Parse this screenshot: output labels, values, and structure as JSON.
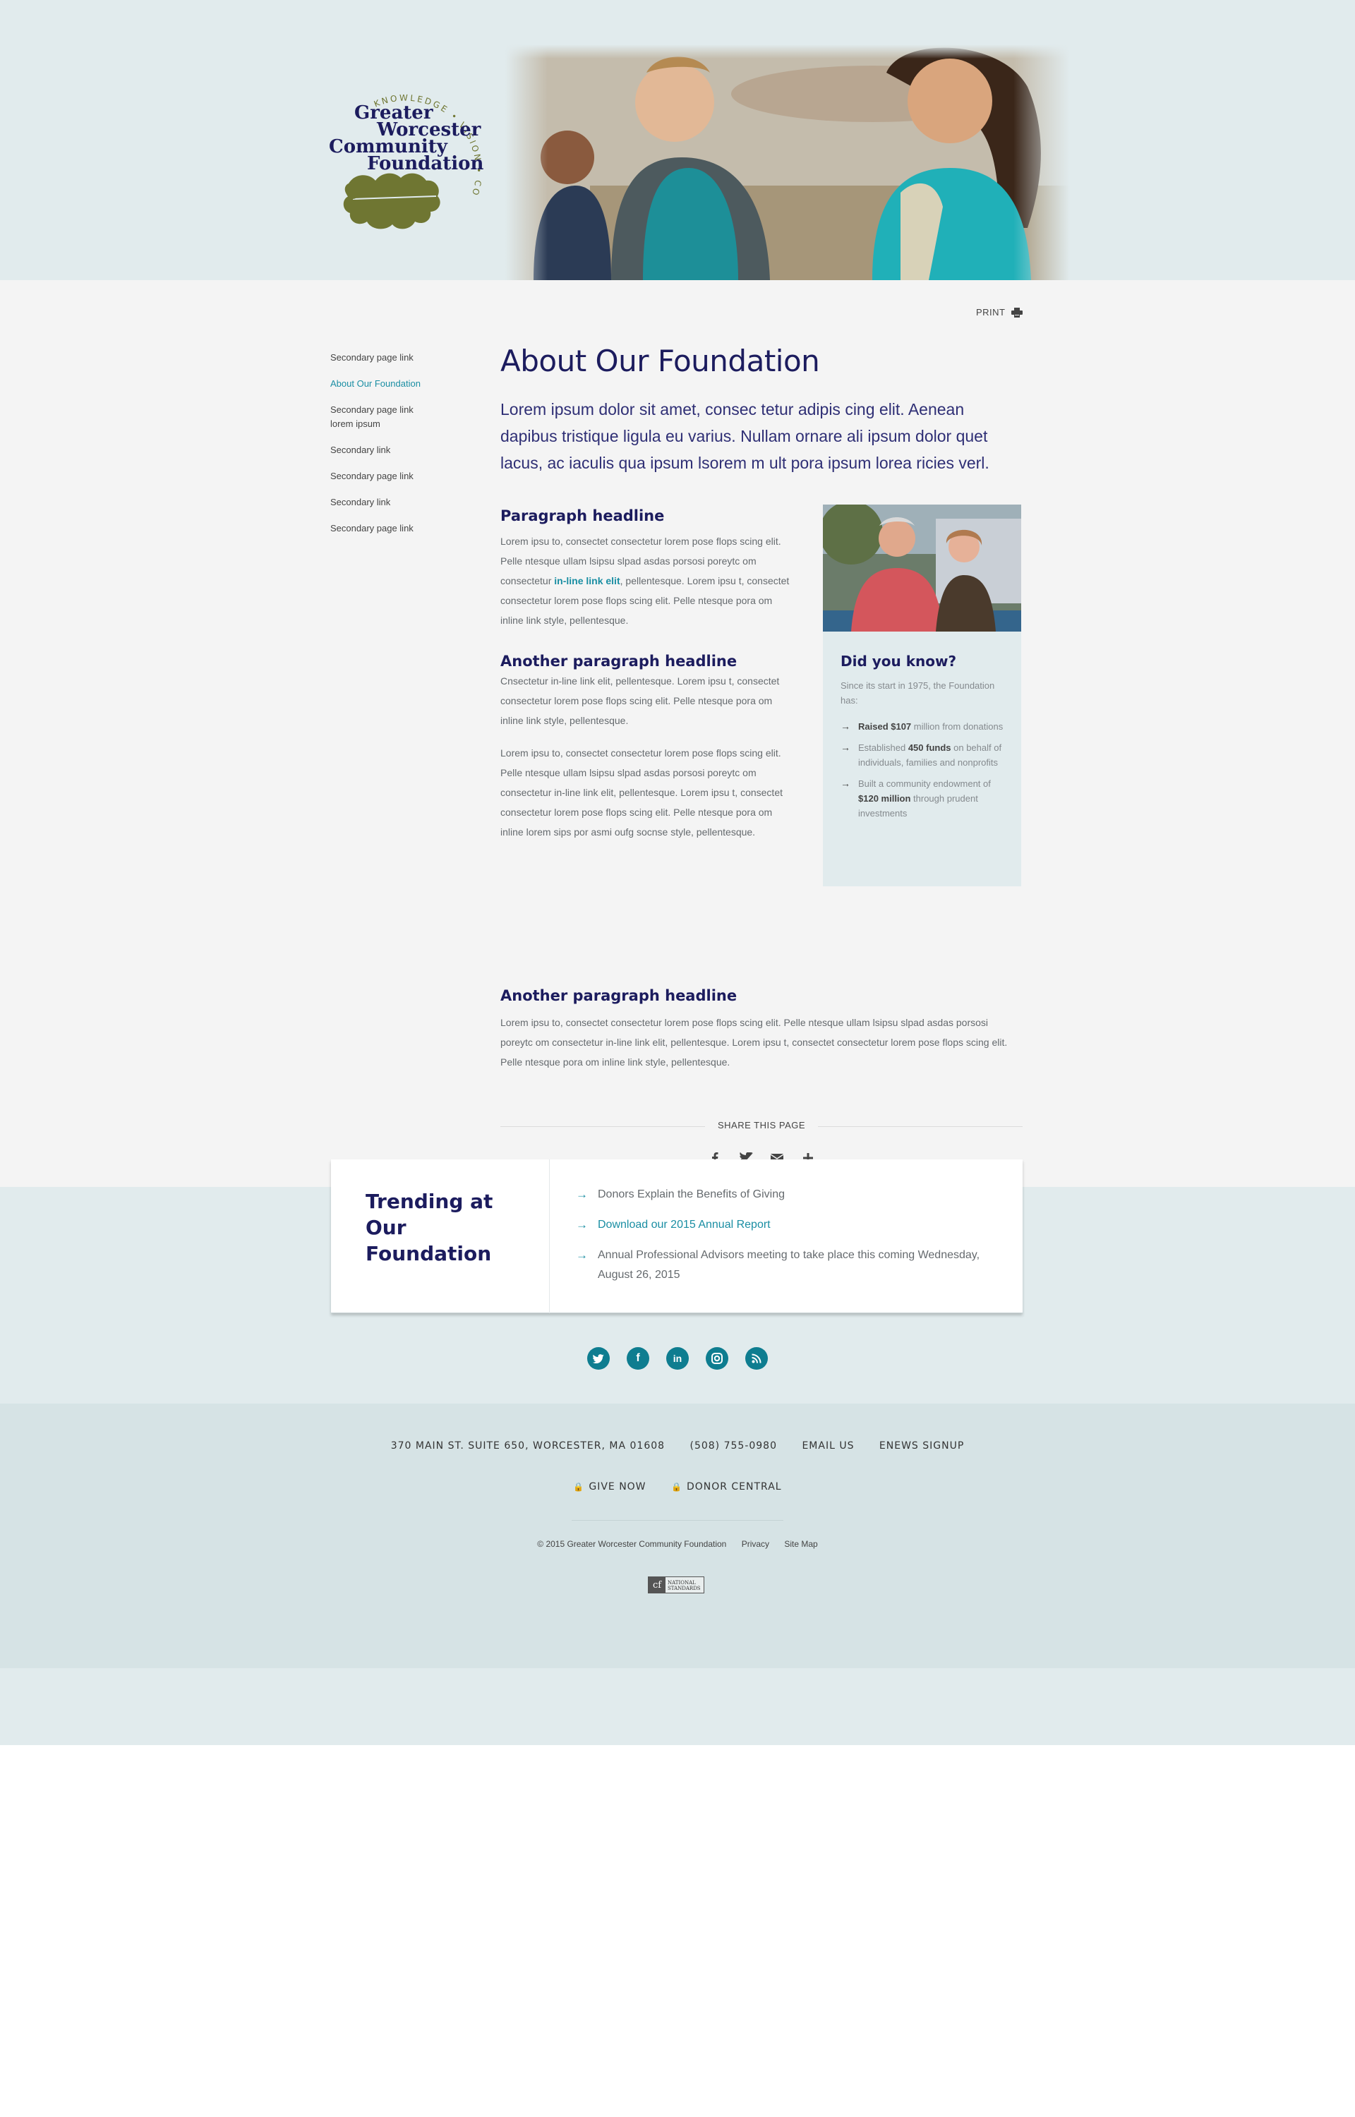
{
  "logo": {
    "name_lines": [
      "Greater",
      "Worcester",
      "Community",
      "Foundation"
    ],
    "tagline": "KNOWLEDGE • VISION • COMMITMENT",
    "leaf_color": "#6f7632"
  },
  "print_label": "PRINT",
  "sidenav": [
    {
      "label": "Secondary page link",
      "active": false
    },
    {
      "label": "About Our Foundation",
      "active": true
    },
    {
      "label": "Secondary page link lorem ipsum",
      "active": false
    },
    {
      "label": "Secondary link",
      "active": false
    },
    {
      "label": "Secondary page link",
      "active": false
    },
    {
      "label": "Secondary link",
      "active": false
    },
    {
      "label": "Secondary page link",
      "active": false
    }
  ],
  "page_title": "About Our Foundation",
  "intro": "Lorem ipsum dolor sit amet, consec tetur adipis cing elit. Aenean dapibus tristique ligula eu varius. Nullam ornare ali ipsum dolor quet lacus, ac iaculis qua ipsum lsorem m ult pora ipsum lorea ricies verl.",
  "section1": {
    "headline": "Paragraph headline",
    "text_before": "Lorem ipsu to, consectet consectetur lorem pose flops scing elit. Pelle ntesque ullam lsipsu slpad asdas porsosi poreytc om consectetur ",
    "link": "in-line link elit",
    "text_after": ", pellentesque. Lorem ipsu t, consectet consectetur lorem pose flops scing elit. Pelle ntesque pora om inline link style, pellentesque."
  },
  "section2": {
    "headline": "Another paragraph headline",
    "para1": "Cnsectetur in-line link elit, pellentesque. Lorem ipsu t, consectet consectetur lorem pose flops scing elit. Pelle ntesque pora om inline link style, pellentesque.",
    "para2": "Lorem ipsu to, consectet consectetur lorem pose flops scing elit. Pelle ntesque ullam lsipsu slpad asdas porsosi poreytc om consectetur in-line link elit, pellentesque. Lorem ipsu t, consectet consectetur lorem pose flops scing elit. Pelle ntesque pora om inline lorem sips por asmi oufg socnse style, pellentesque."
  },
  "section3": {
    "headline": "Another paragraph headline",
    "text": "Lorem ipsu to, consectet consectetur lorem pose flops scing elit. Pelle ntesque ullam lsipsu slpad asdas porsosi poreytc om consectetur in-line link elit, pellentesque. Lorem ipsu t, consectet consectetur lorem pose flops scing elit. Pelle ntesque pora om inline link style, pellentesque."
  },
  "did_you_know": {
    "title": "Did you know?",
    "subtitle": "Since its start in 1975, the Foundation has:",
    "items": [
      {
        "bold": "Raised $107",
        "pre": "",
        "rest": " million from donations"
      },
      {
        "pre": "Established ",
        "bold": "450 funds",
        "rest": " on behalf of individuals, families and nonprofits"
      },
      {
        "pre": "Built a community endowment of ",
        "bold": "$120 million",
        "rest": " through prudent investments"
      }
    ]
  },
  "share": {
    "label": "SHARE THIS PAGE",
    "icons": [
      "facebook-icon",
      "twitter-icon",
      "email-icon",
      "plus-icon"
    ]
  },
  "trending": {
    "title": "Trending at Our Foundation",
    "items": [
      {
        "label": "Donors Explain the Benefits of Giving",
        "link": false
      },
      {
        "label": "Download our 2015 Annual Report",
        "link": true
      },
      {
        "label": "Annual Professional Advisors meeting to take place this coming Wednesday, August 26, 2015",
        "link": false
      }
    ]
  },
  "social_icons": [
    "twitter-icon",
    "facebook-icon",
    "linkedin-icon",
    "instagram-icon",
    "rss-icon"
  ],
  "footer": {
    "address": "370 MAIN ST. SUITE 650, WORCESTER, MA 01608",
    "phone": "(508) 755-0980",
    "email": "EMAIL US",
    "enews": "ENEWS SIGNUP",
    "give_now": "GIVE NOW",
    "donor_central": "DONOR CENTRAL",
    "copyright": "© 2015 Greater Worcester Community Foundation",
    "privacy": "Privacy",
    "sitemap": "Site Map",
    "badge_mark": "cf",
    "badge_text": "National Standards"
  },
  "colors": {
    "navy": "#1c1c5e",
    "teal": "#1a8ea3",
    "social_teal": "#0e7d90",
    "header_bg": "#e1ebed",
    "body_bg": "#f4f4f4",
    "footer_bg": "#d6e3e5"
  }
}
